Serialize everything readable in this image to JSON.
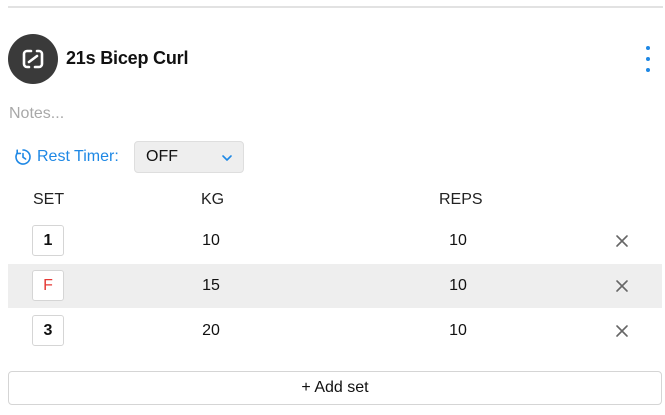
{
  "exercise": {
    "name": "21s Bicep Curl",
    "avatar_icon": "link-chain-icon",
    "menu_icon": "more-vertical-icon"
  },
  "notes": {
    "placeholder": "Notes...",
    "value": ""
  },
  "rest_timer": {
    "label": "Rest Timer:",
    "icon": "timer-icon",
    "value": "OFF"
  },
  "table": {
    "headers": {
      "set": "SET",
      "kg": "KG",
      "reps": "REPS"
    },
    "rows": [
      {
        "set": "1",
        "kg": "10",
        "reps": "10",
        "type": "normal"
      },
      {
        "set": "F",
        "kg": "15",
        "reps": "10",
        "type": "failure"
      },
      {
        "set": "3",
        "kg": "20",
        "reps": "10",
        "type": "normal"
      }
    ]
  },
  "add_set_label": "+ Add set",
  "colors": {
    "accent": "#1e88e5",
    "failure": "#e53935",
    "avatar_bg": "#3a3a3a",
    "row_alt_bg": "#eeeeee"
  }
}
